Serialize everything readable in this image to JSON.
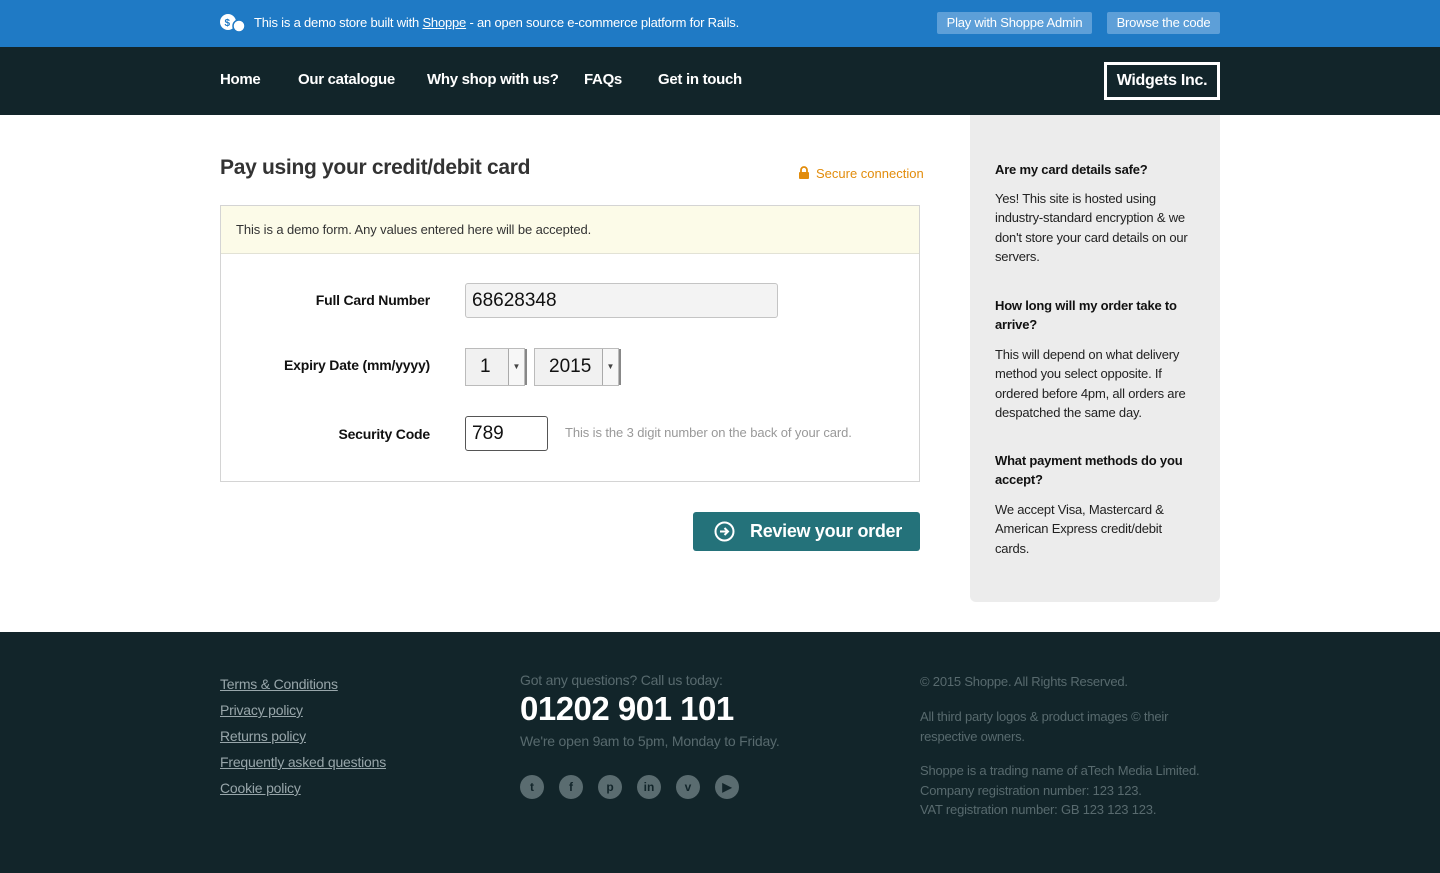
{
  "demo_bar": {
    "message_prefix": "This is a demo store built with ",
    "message_link": "Shoppe",
    "message_suffix": " - an open source e-commerce platform for Rails.",
    "admin_button": "Play with Shoppe Admin",
    "code_button": "Browse the code"
  },
  "nav": {
    "items": [
      "Home",
      "Our catalogue",
      "Why shop with us?",
      "FAQs",
      "Get in touch"
    ],
    "brand": "Widgets Inc."
  },
  "main": {
    "title": "Pay using your credit/debit card",
    "secure": "Secure connection",
    "notice": "This is a demo form. Any values entered here will be accepted.",
    "card_label": "Full Card Number",
    "card_value": "68628348",
    "expiry_label": "Expiry Date (mm/yyyy)",
    "expiry_month": "1",
    "expiry_year": "2015",
    "cvv_label": "Security Code",
    "cvv_value": "789",
    "cvv_hint": "This is the 3 digit number on the back of your card.",
    "review_button": "Review your order"
  },
  "sidebar": {
    "faqs": [
      {
        "q": "Are my card details safe?",
        "a": "Yes! This site is hosted using industry-standard encryption & we don't store your card details on our servers."
      },
      {
        "q": "How long will my order take to arrive?",
        "a": "This will depend on what delivery method you select opposite. If ordered before 4pm, all orders are despatched the same day."
      },
      {
        "q": "What payment methods do you accept?",
        "a": "We accept Visa, Mastercard & American Express credit/debit cards."
      }
    ]
  },
  "footer": {
    "links": [
      "Terms & Conditions",
      "Privacy policy",
      "Returns policy",
      "Frequently asked questions",
      "Cookie policy"
    ],
    "call_lead": "Got any questions? Call us today:",
    "phone": "01202 901 101",
    "hours": "We're open 9am to 5pm, Monday to Friday.",
    "social_icons": [
      "twitter-icon",
      "facebook-icon",
      "pinterest-icon",
      "linkedin-icon",
      "vimeo-icon",
      "youtube-icon"
    ],
    "copyright": "© 2015 Shoppe. All Rights Reserved.",
    "logos_note": "All third party logos & product images © their respective owners.",
    "company_lines": [
      "Shoppe is a trading name of aTech Media Limited.",
      "Company registration number: 123 123.",
      "VAT registration number: GB 123 123 123."
    ]
  },
  "colors": {
    "demo_bar": "#1f7ac5",
    "header": "#12252a",
    "accent_button": "#24727a",
    "secure": "#e28c0b"
  }
}
